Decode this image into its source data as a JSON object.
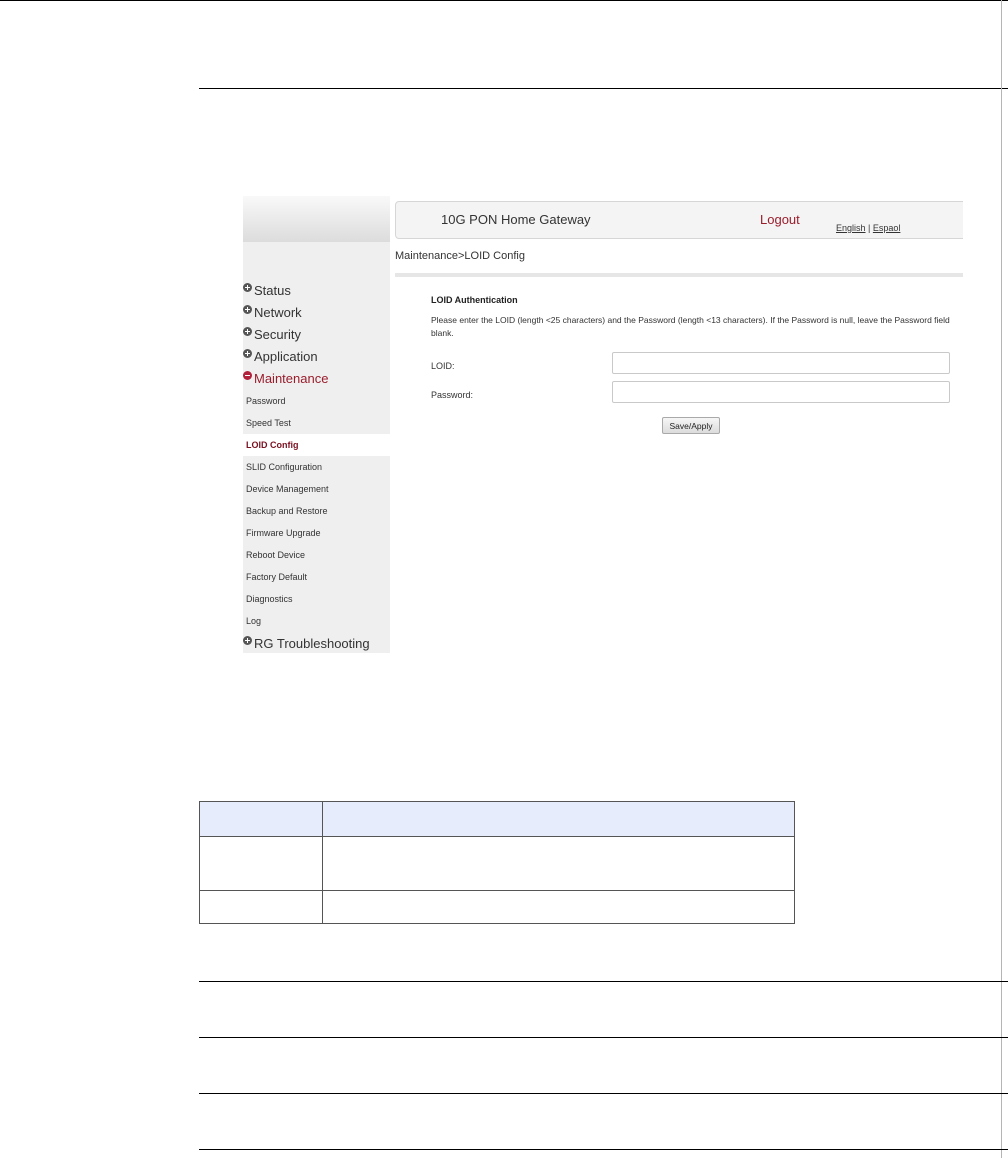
{
  "embedded_screenshot": {
    "header": {
      "title": "10G PON Home Gateway",
      "logout": "Logout",
      "lang_english": "English",
      "lang_separator": " | ",
      "lang_spanish": "Espaol"
    },
    "breadcrumb": "Maintenance>LOID Config",
    "sidebar": {
      "main_items": [
        {
          "label": "Status",
          "expanded": false
        },
        {
          "label": "Network",
          "expanded": false
        },
        {
          "label": "Security",
          "expanded": false
        },
        {
          "label": "Application",
          "expanded": false
        },
        {
          "label": "Maintenance",
          "expanded": true
        },
        {
          "label": "RG Troubleshooting",
          "expanded": false
        }
      ],
      "sub_items": [
        "Password",
        "Speed Test",
        "LOID Config",
        "SLID Configuration",
        "Device Management",
        "Backup and Restore",
        "Firmware Upgrade",
        "Reboot Device",
        "Factory Default",
        "Diagnostics",
        "Log"
      ],
      "selected_sub_item": "LOID Config"
    },
    "form": {
      "section_title": "LOID Authentication",
      "instructions": "Please enter the LOID (length <25 characters) and the Password (length <13 characters). If the Password is null, leave the Password field blank.",
      "loid_label": "LOID:",
      "loid_value": "",
      "password_label": "Password:",
      "password_value": "",
      "save_button": "Save/Apply"
    },
    "colors": {
      "accent": "#9a1d2c",
      "sidebar_bg": "#efefef",
      "expand_icon": "#555555",
      "collapse_icon": "#b2213b"
    }
  },
  "table": {
    "header_bg": "#e6ecfb",
    "headers": [
      "",
      ""
    ],
    "rows": [
      [
        "",
        ""
      ],
      [
        "",
        ""
      ]
    ]
  }
}
